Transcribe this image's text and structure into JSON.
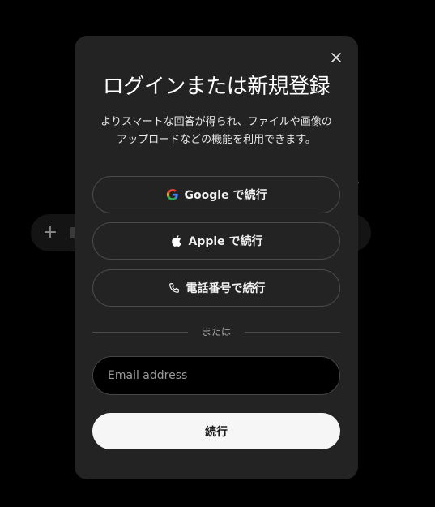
{
  "background": {
    "plus_icon": "+"
  },
  "modal": {
    "title": "ログインまたは新規登録",
    "description": "よりスマートな回答が得られ、ファイルや画像のアップロードなどの機能を利用できます。",
    "close_icon": "close-icon",
    "google_label": "Google で続行",
    "apple_label": "Apple で続行",
    "phone_label": "電話番号で続行",
    "divider_text": "または",
    "email_placeholder": "Email address",
    "email_value": "",
    "continue_label": "続行"
  },
  "colors": {
    "page_bg": "#000000",
    "modal_bg": "#232323",
    "border": "#4a4a4a",
    "primary_button_bg": "#f6f6f6",
    "text": "#ffffff",
    "google_blue": "#4285F4",
    "google_red": "#EA4335",
    "google_yellow": "#FBBC05",
    "google_green": "#34A853"
  }
}
